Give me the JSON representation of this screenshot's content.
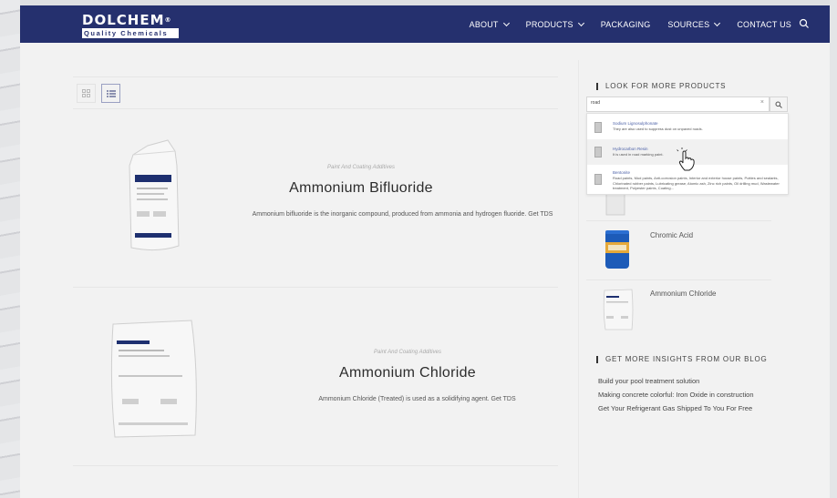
{
  "header": {
    "logo_top": "DOLCHEM",
    "logo_reg": "®",
    "logo_bottom": "Quality Chemicals",
    "nav": [
      {
        "label": "ABOUT",
        "dropdown": true
      },
      {
        "label": "PRODUCTS",
        "dropdown": true
      },
      {
        "label": "PACKAGING",
        "dropdown": false
      },
      {
        "label": "SOURCES",
        "dropdown": true
      },
      {
        "label": "CONTACT US",
        "dropdown": false
      }
    ],
    "search_icon": "search-icon"
  },
  "view_toggle": {
    "grid_icon": "grid-view-icon",
    "list_icon": "list-view-icon",
    "active": "list"
  },
  "products": [
    {
      "category": "Paint And Coating Additives",
      "title": "Ammonium Bifluoride",
      "description": "Ammonium bifluoride is the inorganic compound, produced from ammonia and hydrogen fluoride. Get TDS"
    },
    {
      "category": "Paint And Coating Additives",
      "title": "Ammonium Chloride",
      "description": "Ammonium Chloride (Treated) is used as a solidifying agent. Get TDS"
    }
  ],
  "sidebar": {
    "search_heading": "LOOK FOR MORE PRODUCTS",
    "search_value": "road",
    "clear_symbol": "×",
    "results": [
      {
        "name": "Sodium Lignosulphonate",
        "text": "They are also used to suppress dust on unpaved roads."
      },
      {
        "name": "Hydrocarbon Resin",
        "text": "It is used in road marking paint."
      },
      {
        "name": "Bentonite",
        "text": "Road paints, Mud paints, Anti-corrosion paints, Interior and exterior house paints, Putties and sealants, Chlorinated rubber paints, Lubricating grease, Atomic ash, Zinc rich paints, Oil drilling mud, Wastewater treatment, Polyester paints, Coating..."
      }
    ],
    "side_products": [
      {
        "name": "Chromic Acid"
      },
      {
        "name": "Ammonium Chloride"
      }
    ],
    "blog_heading": "GET MORE INSIGHTS FROM OUR BLOG",
    "blog_links": [
      "Build your pool treatment solution",
      "Making concrete colorful: Iron Oxide in construction",
      "Get Your Refrigerant Gas Shipped To You For Free"
    ]
  },
  "colors": {
    "header_bg": "#25306e",
    "link": "#4d62a8",
    "page_bg": "#f2f2f2"
  }
}
